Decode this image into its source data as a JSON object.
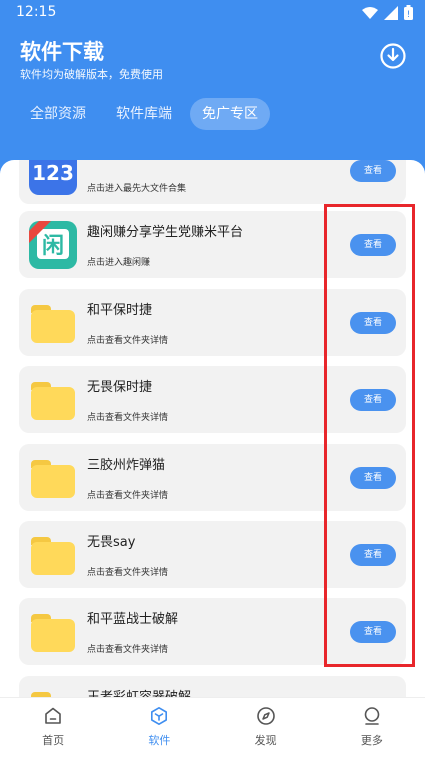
{
  "status": {
    "time": "12:15"
  },
  "header": {
    "title": "软件下载",
    "subtitle": "软件均为破解版本，免费使用"
  },
  "tabs": [
    {
      "label": "全部资源",
      "active": false
    },
    {
      "label": "软件库端",
      "active": false
    },
    {
      "label": "免广专区",
      "active": true
    }
  ],
  "items": [
    {
      "title": "",
      "desc": "点击进入最先大文件合集",
      "button": "查看",
      "icon": "123-app-icon",
      "icon_text": "123"
    },
    {
      "title": "趣闲赚分享学生党赚米平台",
      "desc": "点击进入趣闲赚",
      "button": "查看",
      "icon": "xian-app-icon",
      "icon_text": "闲"
    },
    {
      "title": "和平保时捷",
      "desc": "点击查看文件夹详情",
      "button": "查看",
      "icon": "folder-icon"
    },
    {
      "title": "无畏保时捷",
      "desc": "点击查看文件夹详情",
      "button": "查看",
      "icon": "folder-icon"
    },
    {
      "title": "三胶州炸弹猫",
      "desc": "点击查看文件夹详情",
      "button": "查看",
      "icon": "folder-icon"
    },
    {
      "title": "无畏say",
      "desc": "点击查看文件夹详情",
      "button": "查看",
      "icon": "folder-icon"
    },
    {
      "title": "和平蓝战士破解",
      "desc": "点击查看文件夹详情",
      "button": "查看",
      "icon": "folder-icon"
    },
    {
      "title": "王者彩虹容器破解",
      "desc": "",
      "button": "",
      "icon": "folder-icon"
    }
  ],
  "nav": [
    {
      "label": "首页",
      "icon": "home-icon",
      "active": false
    },
    {
      "label": "软件",
      "icon": "software-icon",
      "active": true
    },
    {
      "label": "发现",
      "icon": "compass-icon",
      "active": false
    },
    {
      "label": "更多",
      "icon": "more-icon",
      "active": false
    }
  ],
  "colors": {
    "primary": "#3f8ef0",
    "button": "#4a92ef",
    "highlight": "#e8262b"
  }
}
